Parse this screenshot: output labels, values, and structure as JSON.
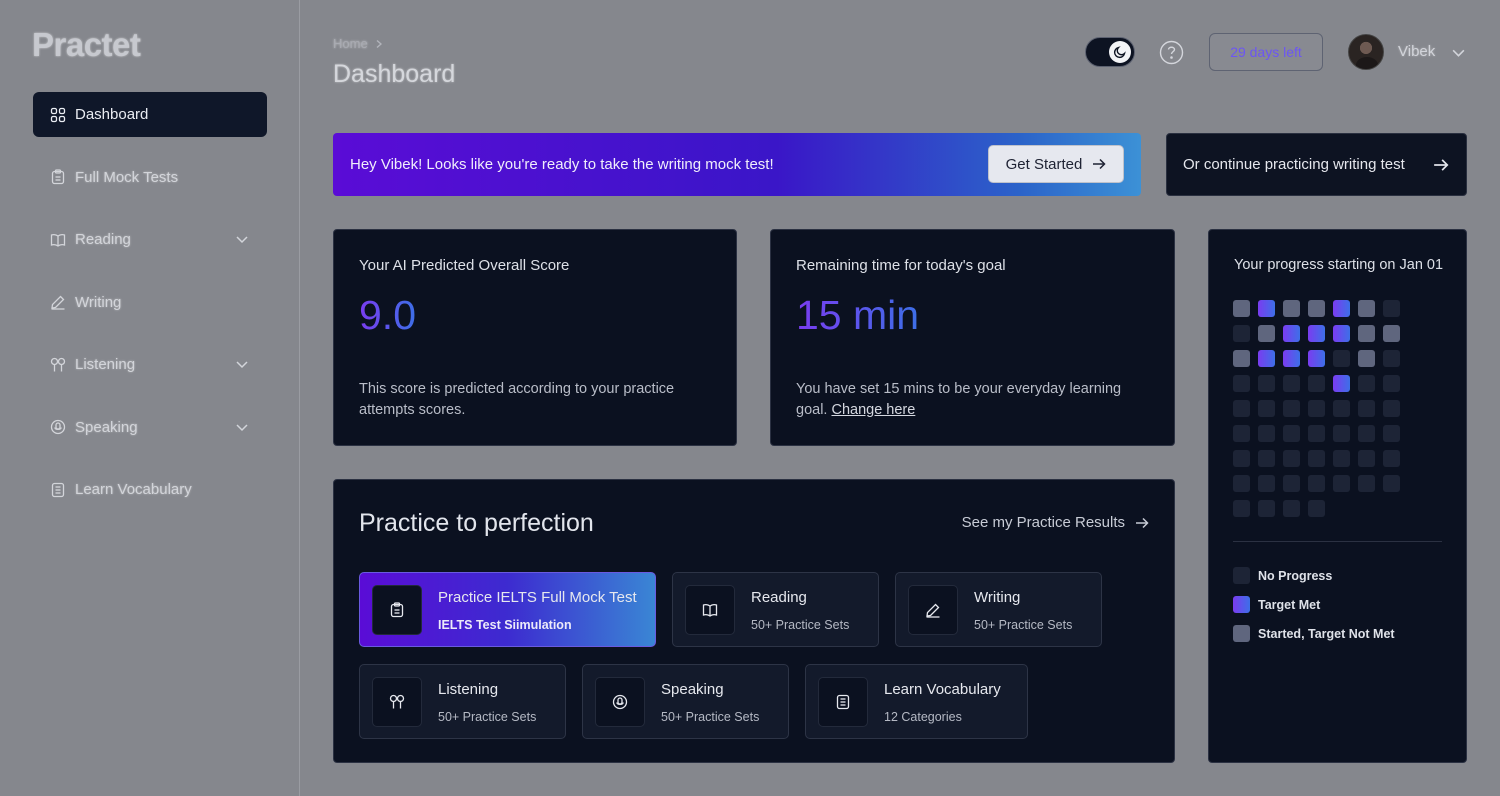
{
  "app": {
    "logo": "Practet"
  },
  "sidebar": {
    "items": [
      {
        "label": "Dashboard",
        "icon": "grid-icon",
        "active": true,
        "has_children": false
      },
      {
        "label": "Full Mock Tests",
        "icon": "clipboard-icon",
        "active": false,
        "has_children": false
      },
      {
        "label": "Reading",
        "icon": "book-open-icon",
        "active": false,
        "has_children": true
      },
      {
        "label": "Writing",
        "icon": "pencil-icon",
        "active": false,
        "has_children": false
      },
      {
        "label": "Listening",
        "icon": "earbuds-icon",
        "active": false,
        "has_children": true
      },
      {
        "label": "Speaking",
        "icon": "microphone-icon",
        "active": false,
        "has_children": true
      },
      {
        "label": "Learn Vocabulary",
        "icon": "notebook-icon",
        "active": false,
        "has_children": false
      }
    ]
  },
  "header": {
    "breadcrumb": "Home",
    "title": "Dashboard",
    "days_left": "29 days left",
    "user_name": "Vibek"
  },
  "banner": {
    "text": "Hey Vibek! Looks like you're ready to take the writing mock test!",
    "button": "Get Started",
    "continue_text": "Or continue practicing writing test"
  },
  "score_card": {
    "label": "Your AI Predicted Overall Score",
    "value": "9.0",
    "desc": "This score is predicted according to your practice attempts scores."
  },
  "goal_card": {
    "label": "Remaining time for today's goal",
    "value": "15 min",
    "desc": "You have set 15 mins to be your everyday learning goal.",
    "link": "Change here"
  },
  "progress": {
    "label": "Your progress starting on Jan 01",
    "grid": [
      [
        2,
        1,
        2,
        2,
        1,
        2,
        0
      ],
      [
        0,
        2,
        1,
        1,
        1,
        2,
        2
      ],
      [
        2,
        1,
        1,
        1,
        0,
        2,
        0
      ],
      [
        0,
        0,
        0,
        0,
        1,
        0,
        0
      ],
      [
        0,
        0,
        0,
        0,
        0,
        0,
        0
      ],
      [
        0,
        0,
        0,
        0,
        0,
        0,
        0
      ],
      [
        0,
        0,
        0,
        0,
        0,
        0,
        0
      ],
      [
        0,
        0,
        0,
        0,
        0,
        0,
        0
      ],
      [
        0,
        0,
        0,
        0
      ]
    ],
    "legend": [
      {
        "label": "No Progress",
        "level": 0
      },
      {
        "label": "Target Met",
        "level": 1
      },
      {
        "label": "Started, Target Not Met",
        "level": 2
      }
    ]
  },
  "practice": {
    "title": "Practice to perfection",
    "results_link": "See my Practice Results",
    "tiles": [
      {
        "title": "Practice IELTS Full Mock Test",
        "sub": "IELTS Test Siimulation",
        "icon": "clipboard-icon"
      },
      {
        "title": "Reading",
        "sub": "50+ Practice Sets",
        "icon": "book-open-icon"
      },
      {
        "title": "Writing",
        "sub": "50+ Practice Sets",
        "icon": "pencil-icon"
      },
      {
        "title": "Listening",
        "sub": "50+ Practice Sets",
        "icon": "earbuds-icon"
      },
      {
        "title": "Speaking",
        "sub": "50+ Practice Sets",
        "icon": "microphone-icon"
      },
      {
        "title": "Learn Vocabulary",
        "sub": "12 Categories",
        "icon": "notebook-icon"
      }
    ]
  },
  "colors": {
    "accent_start": "#7a3cf0",
    "accent_end": "#3d6fe8",
    "card_bg": "#0b1120",
    "page_bg": "#85878d"
  }
}
